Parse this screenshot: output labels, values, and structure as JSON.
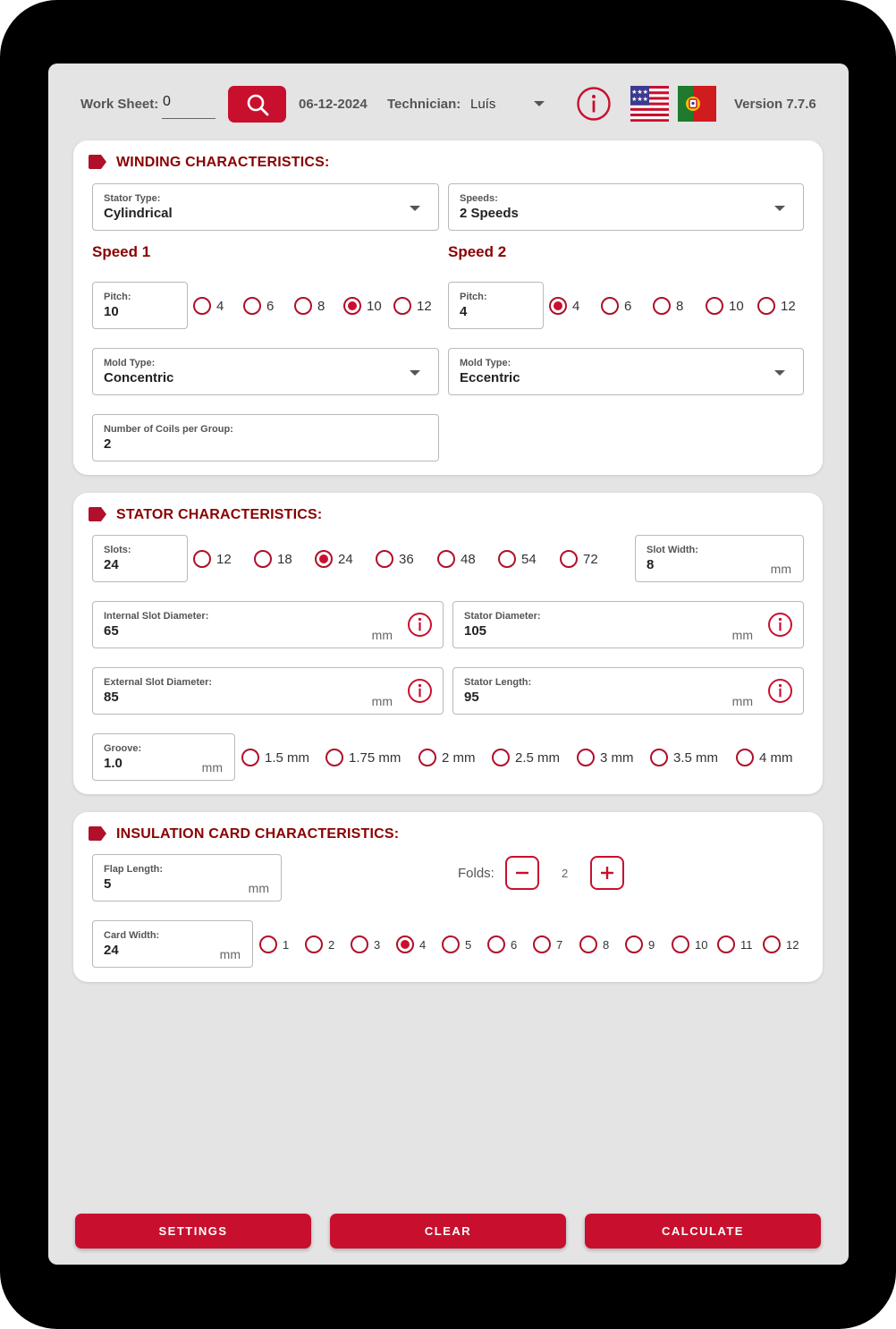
{
  "header": {
    "worksheet_label": "Work Sheet:",
    "worksheet_value": "0",
    "date": "06-12-2024",
    "technician_label": "Technician:",
    "technician_value": "Luís",
    "version": "Version 7.7.6"
  },
  "winding": {
    "title": "WINDING CHARACTERISTICS:",
    "stator_type": {
      "label": "Stator Type:",
      "value": "Cylindrical"
    },
    "speeds": {
      "label": "Speeds:",
      "value": "2 Speeds"
    },
    "speed1": {
      "title": "Speed 1",
      "pitch": {
        "label": "Pitch:",
        "value": "10"
      },
      "pitch_options": [
        "4",
        "6",
        "8",
        "10",
        "12"
      ],
      "pitch_selected": "10",
      "mold": {
        "label": "Mold Type:",
        "value": "Concentric"
      }
    },
    "speed2": {
      "title": "Speed 2",
      "pitch": {
        "label": "Pitch:",
        "value": "4"
      },
      "pitch_options": [
        "4",
        "6",
        "8",
        "10",
        "12"
      ],
      "pitch_selected": "4",
      "mold": {
        "label": "Mold Type:",
        "value": "Eccentric"
      }
    },
    "coils": {
      "label": "Number of Coils per Group:",
      "value": "2"
    }
  },
  "stator": {
    "title": "STATOR CHARACTERISTICS:",
    "slots": {
      "label": "Slots:",
      "value": "24"
    },
    "slot_options": [
      "12",
      "18",
      "24",
      "36",
      "48",
      "54",
      "72"
    ],
    "slot_selected": "24",
    "slot_width": {
      "label": "Slot Width:",
      "value": "8",
      "unit": "mm"
    },
    "internal_slot_diameter": {
      "label": "Internal Slot Diameter:",
      "value": "65",
      "unit": "mm"
    },
    "stator_diameter": {
      "label": "Stator Diameter:",
      "value": "105",
      "unit": "mm"
    },
    "external_slot_diameter": {
      "label": "External Slot Diameter:",
      "value": "85",
      "unit": "mm"
    },
    "stator_length": {
      "label": "Stator Length:",
      "value": "95",
      "unit": "mm"
    },
    "groove": {
      "label": "Groove:",
      "value": "1.0",
      "unit": "mm"
    },
    "groove_options": [
      "1.5 mm",
      "1.75 mm",
      "2 mm",
      "2.5 mm",
      "3 mm",
      "3.5 mm",
      "4 mm"
    ],
    "groove_selected": ""
  },
  "insulation": {
    "title": "INSULATION CARD CHARACTERISTICS:",
    "flap_length": {
      "label": "Flap Length:",
      "value": "5",
      "unit": "mm"
    },
    "folds_label": "Folds:",
    "folds_value": "2",
    "card_width": {
      "label": "Card Width:",
      "value": "24",
      "unit": "mm"
    },
    "card_options": [
      "1",
      "2",
      "3",
      "4",
      "5",
      "6",
      "7",
      "8",
      "9",
      "10",
      "11",
      "12"
    ],
    "card_selected": "4"
  },
  "buttons": {
    "settings": "SETTINGS",
    "clear": "CLEAR",
    "calculate": "CALCULATE"
  },
  "colors": {
    "accent": "#c8102e",
    "section_title": "#8b0000",
    "background": "#e4e4e4"
  },
  "icons": [
    "search-icon",
    "info-icon",
    "us-flag-icon",
    "pt-flag-icon",
    "dropdown-caret-icon",
    "section-tag-icon",
    "minus-icon",
    "plus-icon"
  ]
}
